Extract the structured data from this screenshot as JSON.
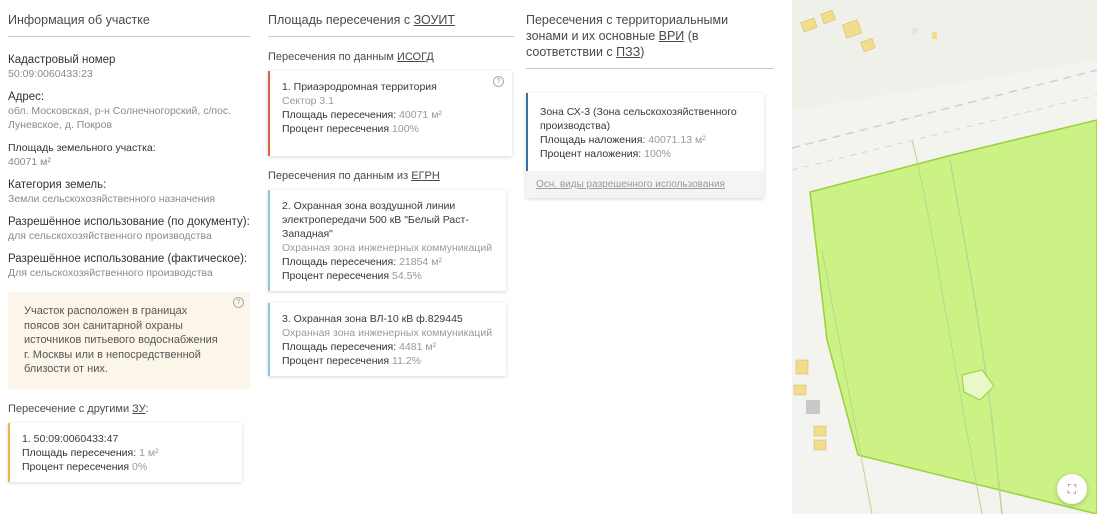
{
  "info": {
    "title": "Информация об участке",
    "cadastral_label": "Кадастровый номер",
    "cadastral_value": "50:09:0060433:23",
    "address_label": "Адрес:",
    "address_value": "обл. Московская, р-н Солнечногорский, с/пос. Луневское, д. Покров",
    "area_label": "Площадь земельного участка:",
    "area_value": "40071 м²",
    "category_label": "Категория земель:",
    "category_value": "Земли сельскохозяйственного назначения",
    "use_doc_label": "Разрешённое использование (по документу):",
    "use_doc_value": "для сельскохозяйственного производства",
    "use_fact_label": "Разрешённое использование (фактическое):",
    "use_fact_value": "Для сельскохозяйственного производства",
    "warning": "Участок расположен в границах поясов зон санитарной охраны источников питьевого водоснабжения г. Москвы или в непосредственной близости от них.",
    "other_label_prefix": "Пересечение с другими ",
    "other_label_link": "ЗУ",
    "other_label_suffix": ":",
    "other": {
      "title": "1. 50:09:0060433:47",
      "area_key": "Площадь пересечения: ",
      "area_val": "1 м²",
      "pct_key": "Процент пересечения ",
      "pct_val": "0%"
    }
  },
  "zouit": {
    "title_prefix": "Площадь пересечения с ",
    "title_link": "ЗОУИТ",
    "isogd_prefix": "Пересечения по данным ",
    "isogd_link": "ИСОГД",
    "isogd_card": {
      "title": "1. Приаэродромная территория",
      "sub": "Сектор 3.1",
      "area_key": "Площадь пересечения: ",
      "area_val": "40071 м²",
      "pct_key": "Процент пересечения ",
      "pct_val": "100%"
    },
    "egrn_prefix": "Пересечения по данным из ",
    "egrn_link": "ЕГРН",
    "egrn_cards": [
      {
        "title": "2. Охранная зона воздушной линии электропередачи 500 кВ \"Белый Раст-Западная\"",
        "sub": "Охранная зона инженерных коммуникаций",
        "area_key": "Площадь пересечения: ",
        "area_val": "21854 м²",
        "pct_key": "Процент пересечения ",
        "pct_val": "54.5%"
      },
      {
        "title": "3. Охранная зона ВЛ-10 кВ ф.829445",
        "sub": "Охранная зона инженерных коммуникаций",
        "area_key": "Площадь пересечения: ",
        "area_val": "4481 м²",
        "pct_key": "Процент пересечения ",
        "pct_val": "11.2%"
      }
    ]
  },
  "zones": {
    "title_line1": "Пересечения с территориальными",
    "title_line2_prefix": "зонами и их основные ",
    "title_line2_link": "ВРИ",
    "title_line2_suffix": " (в",
    "title_line3_prefix": "соответствии с ",
    "title_line3_link": "ПЗЗ",
    "title_line3_suffix": ")",
    "card": {
      "title": "Зона СХ-3 (Зона сельскохозяйственного производства)",
      "area_key": "Площадь наложения: ",
      "area_val": "40071.13 м²",
      "pct_key": "Процент наложения: ",
      "pct_val": "100%"
    },
    "vri_link": "Осн. виды разрешенного использования"
  },
  "map": {
    "expand_icon": "expand-icon"
  },
  "colors": {
    "isogd_bar": "#e06040",
    "egrn_bar": "#8cc8e0",
    "zone_bar": "#3a6fa0",
    "other_bar": "#e8b84a",
    "parcel_fill": "#c8f27a",
    "parcel_stroke": "#9ad13a"
  }
}
